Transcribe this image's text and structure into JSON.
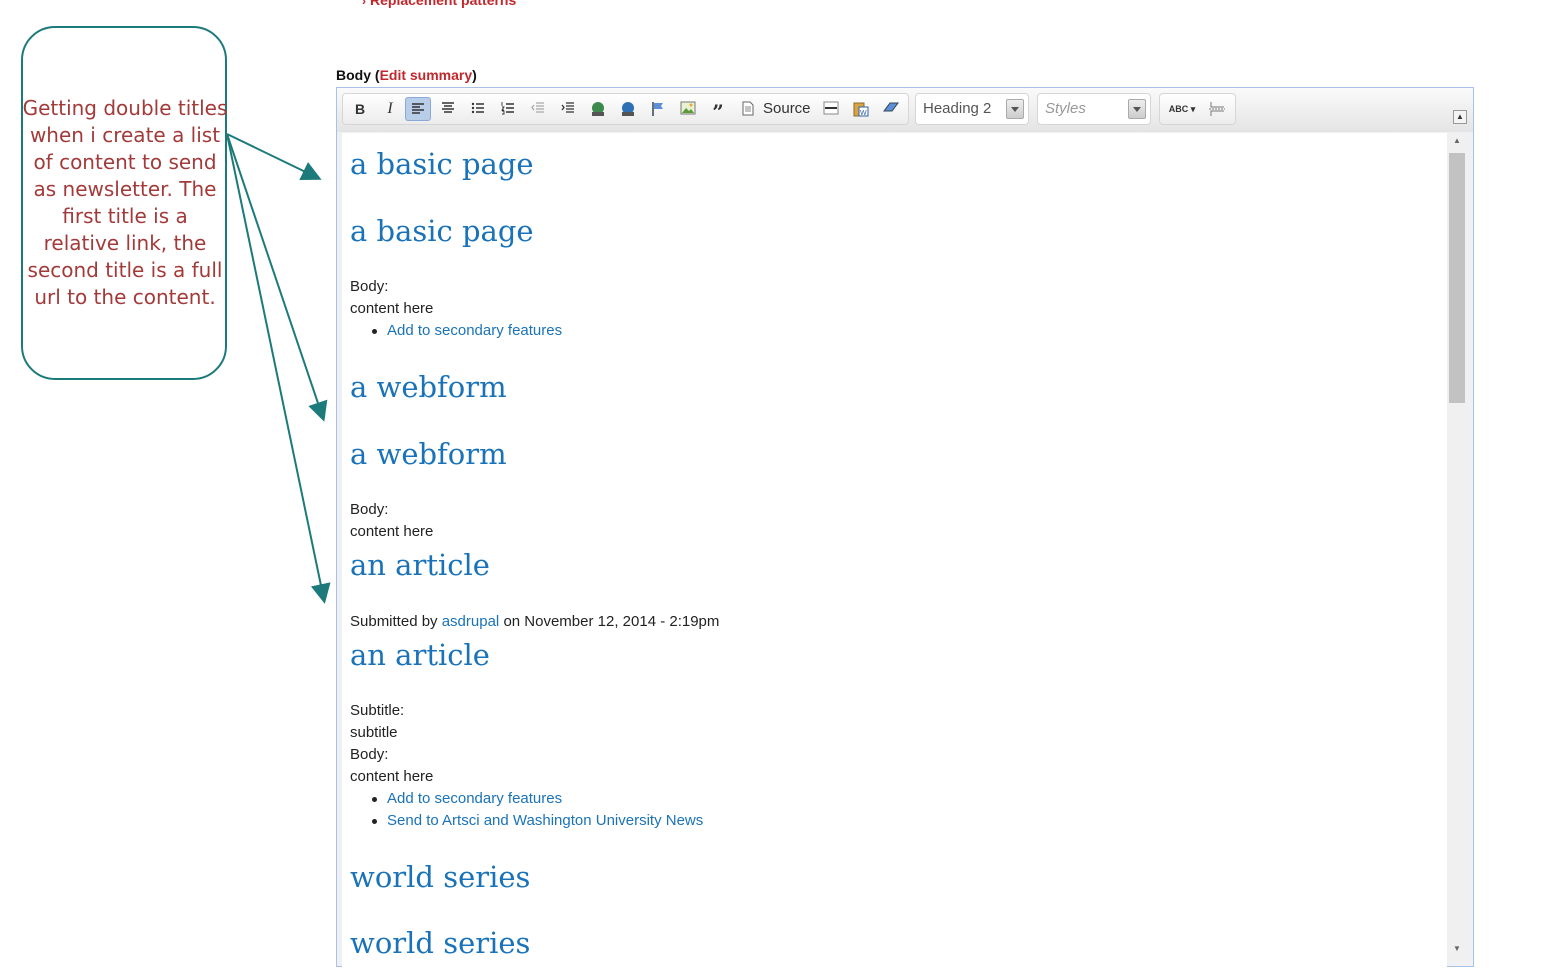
{
  "top_link": {
    "label": "Replacement patterns"
  },
  "callout": {
    "text": "Getting double titles when i create a list of content to send as newsletter. The first title is a relative link, the second title is a full url to the content."
  },
  "field": {
    "label": "Body",
    "edit_summary": "Edit summary"
  },
  "toolbar": {
    "bold": "B",
    "italic": "I",
    "source_label": "Source",
    "format_value": "Heading 2",
    "styles_placeholder": "Styles",
    "spellcheck_label": "ABC"
  },
  "content": {
    "h1": "a basic page",
    "h2": "a basic page",
    "body1_label": "Body:",
    "body1_text": "content here",
    "body1_link": "Add to secondary features",
    "h3": "a webform",
    "h4": "a webform",
    "body2_label": "Body:",
    "body2_text": "content here",
    "h5": "an article",
    "submitted_prefix": "Submitted by",
    "submitted_user": "asdrupal",
    "submitted_suffix": "on November 12, 2014 - 2:19pm",
    "h6": "an article",
    "subtitle_label": "Subtitle:",
    "subtitle_text": "subtitle",
    "body3_label": "Body:",
    "body3_text": "content here",
    "body3_link1": "Add to secondary features",
    "body3_link2": "Send to Artsci and Washington University News",
    "h7": "world series",
    "h8": "world series"
  },
  "colors": {
    "accent_red": "#c0282d",
    "link_blue": "#1a73b8",
    "callout_border": "#1d7a7a",
    "callout_text": "#a33a3a"
  }
}
